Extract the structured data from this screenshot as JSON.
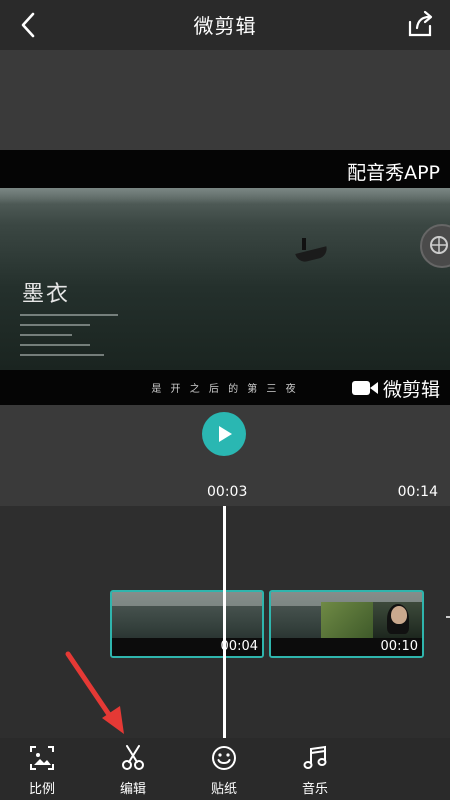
{
  "header": {
    "title": "微剪辑",
    "back_icon": "back-chevron-icon",
    "share_icon": "share-export-icon"
  },
  "preview": {
    "watermark_top": "配音秀APP",
    "watermark_bottom": "微剪辑",
    "calligraphy_title": "墨衣",
    "subtitle": "是 开 之 后 的 第 三 夜"
  },
  "playback": {
    "current_time": "00:03",
    "total_time": "00:14"
  },
  "timeline": {
    "clips": [
      {
        "duration": "00:04"
      },
      {
        "duration": "00:10"
      }
    ]
  },
  "tabs": [
    {
      "label": "比例",
      "icon": "ratio-image-icon"
    },
    {
      "label": "编辑",
      "icon": "scissors-icon"
    },
    {
      "label": "贴纸",
      "icon": "smiley-sticker-icon"
    },
    {
      "label": "音乐",
      "icon": "music-note-icon"
    }
  ],
  "colors": {
    "accent": "#2ab7b2",
    "arrow": "#e53935"
  }
}
